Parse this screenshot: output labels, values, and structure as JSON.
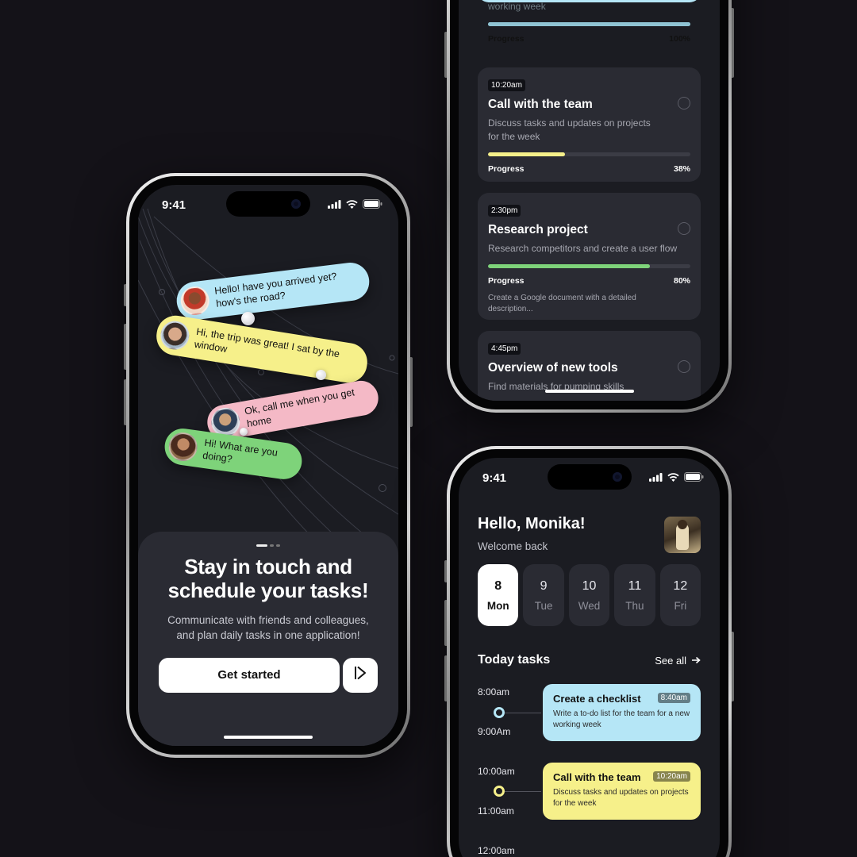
{
  "colors": {
    "background": "#141218",
    "screen": "#1b1c22",
    "card": "#2a2b33",
    "blue": "#b5e6f6",
    "yellow": "#f6f08a",
    "pink": "#f4b9c6",
    "green": "#7ed37a",
    "purple": "#7a67e0"
  },
  "left_phone": {
    "status_time": "9:41",
    "bubbles": [
      {
        "text": "Hello! have you arrived yet? how's the road?",
        "color": "#b5e6f6"
      },
      {
        "text": "Hi, the trip was great! I sat by the window",
        "color": "#f6f08a"
      },
      {
        "text": "Ok, call me when you get home",
        "color": "#f4b9c6"
      },
      {
        "text": "Hi! What are you doing?",
        "color": "#7ed37a"
      }
    ],
    "title": "Stay in touch and schedule your tasks!",
    "subtitle": "Communicate with friends and colleagues, and plan daily tasks in one application!",
    "cta_label": "Get started",
    "next_icon": "play-next-icon"
  },
  "tasks_phone": {
    "partial_card": {
      "desc_tail": "working week",
      "progress_label": "Progress",
      "progress_value": "100%",
      "progress": 1.0
    },
    "cards": [
      {
        "time": "10:20am",
        "title": "Call with the team",
        "desc": "Discuss tasks and updates on projects for the week",
        "progress_label": "Progress",
        "progress_value": "38%",
        "progress": 0.38,
        "color": "#f6f08a"
      },
      {
        "time": "2:30pm",
        "title": "Research project",
        "desc": "Research competitors and create a user flow",
        "progress_label": "Progress",
        "progress_value": "80%",
        "progress": 0.8,
        "color": "#7ed37a",
        "note": "Create a Google document with a detailed description..."
      },
      {
        "time": "4:45pm",
        "title": "Overview of new tools",
        "desc": "Find materials for pumping skills",
        "color": "#7a67e0"
      }
    ]
  },
  "home_phone": {
    "status_time": "9:41",
    "greeting": "Hello, Monika!",
    "welcome": "Welcome back",
    "days": [
      {
        "num": "8",
        "name": "Mon",
        "selected": true
      },
      {
        "num": "9",
        "name": "Tue",
        "selected": false
      },
      {
        "num": "10",
        "name": "Wed",
        "selected": false
      },
      {
        "num": "11",
        "name": "Thu",
        "selected": false
      },
      {
        "num": "12",
        "name": "Fri",
        "selected": false
      }
    ],
    "section_title": "Today tasks",
    "see_all": "See all",
    "timeline": [
      {
        "start": "8:00am",
        "end": "9:00Am",
        "title": "Create a checklist",
        "chip": "8:40am",
        "desc": "Write a to-do list for the team for a new working week",
        "color": "#b5e6f6",
        "dot_color": "#b5e6f6"
      },
      {
        "start": "10:00am",
        "end": "11:00am",
        "title": "Call with the team",
        "chip": "10:20am",
        "desc": "Discuss tasks and updates on projects for the week",
        "color": "#f6f08a",
        "dot_color": "#f6f08a"
      }
    ],
    "next_time": "12:00am"
  }
}
